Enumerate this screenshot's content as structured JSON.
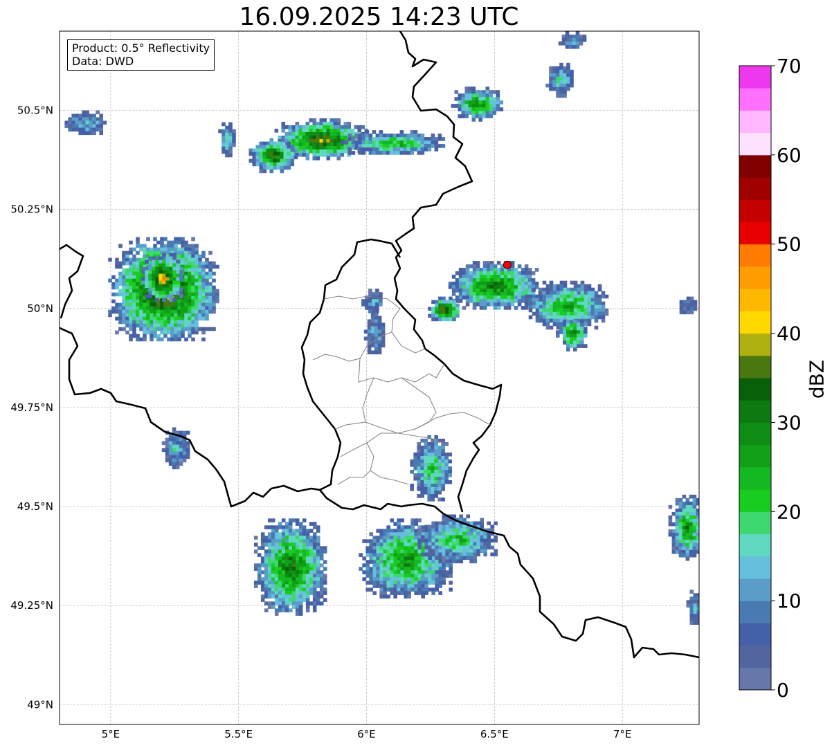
{
  "title": "16.09.2025 14:23 UTC",
  "info": {
    "product": "Product: 0.5° Reflectivity",
    "source": "Data: DWD"
  },
  "map": {
    "lon_range": [
      4.8,
      7.3
    ],
    "lat_range": [
      48.95,
      50.7
    ],
    "lon_ticks": [
      {
        "value": 5.0,
        "label": "5°E"
      },
      {
        "value": 5.5,
        "label": "5.5°E"
      },
      {
        "value": 6.0,
        "label": "6°E"
      },
      {
        "value": 6.5,
        "label": "6.5°E"
      },
      {
        "value": 7.0,
        "label": "7°E"
      }
    ],
    "lat_ticks": [
      {
        "value": 49.0,
        "label": "49°N"
      },
      {
        "value": 49.25,
        "label": "49.25°N"
      },
      {
        "value": 49.5,
        "label": "49.5°N"
      },
      {
        "value": 49.75,
        "label": "49.75°N"
      },
      {
        "value": 50.0,
        "label": "50°N"
      },
      {
        "value": 50.25,
        "label": "50.25°N"
      },
      {
        "value": 50.5,
        "label": "50.5°N"
      }
    ],
    "radar_site": {
      "lon": 6.55,
      "lat": 50.11,
      "color": "#ff0000"
    },
    "echoes": [
      {
        "lon": 5.2,
        "lat": 50.05,
        "rx": 0.21,
        "ry": 0.13,
        "peak": 42
      },
      {
        "lon": 5.2,
        "lat": 50.08,
        "rx": 0.08,
        "ry": 0.06,
        "peak": 46
      },
      {
        "lon": 5.82,
        "lat": 50.43,
        "rx": 0.18,
        "ry": 0.05,
        "peak": 40
      },
      {
        "lon": 5.63,
        "lat": 50.39,
        "rx": 0.09,
        "ry": 0.04,
        "peak": 38
      },
      {
        "lon": 6.1,
        "lat": 50.42,
        "rx": 0.2,
        "ry": 0.03,
        "peak": 26
      },
      {
        "lon": 6.43,
        "lat": 50.52,
        "rx": 0.1,
        "ry": 0.04,
        "peak": 30
      },
      {
        "lon": 5.45,
        "lat": 50.43,
        "rx": 0.03,
        "ry": 0.04,
        "peak": 18
      },
      {
        "lon": 6.5,
        "lat": 50.06,
        "rx": 0.18,
        "ry": 0.06,
        "peak": 34
      },
      {
        "lon": 6.3,
        "lat": 50.0,
        "rx": 0.06,
        "ry": 0.03,
        "peak": 44
      },
      {
        "lon": 6.78,
        "lat": 50.01,
        "rx": 0.16,
        "ry": 0.06,
        "peak": 28
      },
      {
        "lon": 6.8,
        "lat": 49.94,
        "rx": 0.06,
        "ry": 0.04,
        "peak": 32
      },
      {
        "lon": 6.03,
        "lat": 49.94,
        "rx": 0.04,
        "ry": 0.05,
        "peak": 14
      },
      {
        "lon": 6.02,
        "lat": 50.02,
        "rx": 0.04,
        "ry": 0.03,
        "peak": 14
      },
      {
        "lon": 5.7,
        "lat": 49.35,
        "rx": 0.14,
        "ry": 0.12,
        "peak": 34
      },
      {
        "lon": 6.15,
        "lat": 49.37,
        "rx": 0.18,
        "ry": 0.1,
        "peak": 30
      },
      {
        "lon": 6.35,
        "lat": 49.42,
        "rx": 0.15,
        "ry": 0.06,
        "peak": 24
      },
      {
        "lon": 6.25,
        "lat": 49.6,
        "rx": 0.08,
        "ry": 0.08,
        "peak": 24
      },
      {
        "lon": 5.25,
        "lat": 49.65,
        "rx": 0.05,
        "ry": 0.05,
        "peak": 16
      },
      {
        "lon": 7.25,
        "lat": 49.45,
        "rx": 0.07,
        "ry": 0.08,
        "peak": 30
      },
      {
        "lon": 4.9,
        "lat": 50.47,
        "rx": 0.08,
        "ry": 0.03,
        "peak": 16
      },
      {
        "lon": 6.75,
        "lat": 50.58,
        "rx": 0.05,
        "ry": 0.04,
        "peak": 18
      },
      {
        "lon": 6.8,
        "lat": 50.68,
        "rx": 0.05,
        "ry": 0.02,
        "peak": 14
      },
      {
        "lon": 7.25,
        "lat": 50.01,
        "rx": 0.04,
        "ry": 0.02,
        "peak": 8
      },
      {
        "lon": 7.28,
        "lat": 49.25,
        "rx": 0.03,
        "ry": 0.04,
        "peak": 14
      }
    ]
  },
  "colorbar": {
    "label": "dBZ",
    "min": 0,
    "max": 70,
    "tick_values": [
      0,
      10,
      20,
      30,
      40,
      50,
      60,
      70
    ],
    "tick_labels": [
      "0",
      "10",
      "20",
      "30",
      "40",
      "50",
      "60",
      "70"
    ],
    "colors": [
      "#6677aa",
      "#52659f",
      "#4460a8",
      "#4a7ab2",
      "#5a9dc8",
      "#66c0dd",
      "#60d8c0",
      "#3ed870",
      "#18cc20",
      "#14b820",
      "#12a018",
      "#0e8c14",
      "#0c7a10",
      "#086008",
      "#4a7810",
      "#b0b010",
      "#ffd800",
      "#ffb800",
      "#ff9c00",
      "#ff7c00",
      "#e80000",
      "#c40000",
      "#a00000",
      "#800000",
      "#ffe0ff",
      "#ffb8ff",
      "#ff70ff",
      "#ee38ee"
    ]
  }
}
